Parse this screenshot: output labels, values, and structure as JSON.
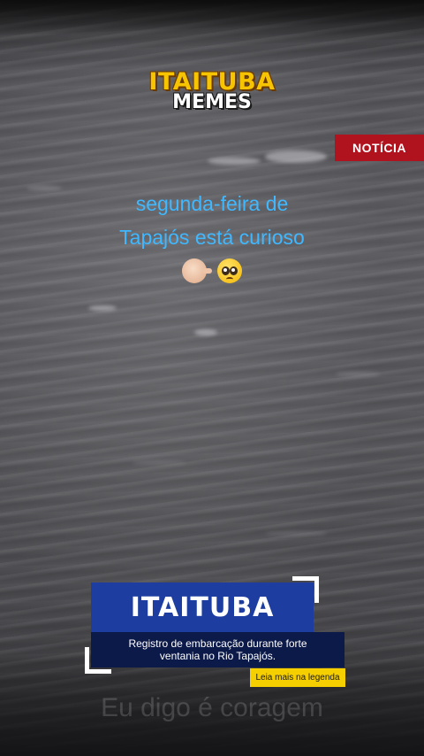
{
  "logo": {
    "line1": "ITAITUBA",
    "line2": "MEMES"
  },
  "badge": {
    "label": "NOTÍCIA"
  },
  "caption": {
    "line1": "segunda-feira de",
    "line2": "Tapajós está curioso"
  },
  "emojis": {
    "first": "pinching-hand-icon",
    "second": "pleading-face-icon"
  },
  "lower_third": {
    "city": "ITAITUBA",
    "headline_line1": "Registro de embarcação durante forte",
    "headline_line2": "ventania no Rio Tapajós.",
    "read_more": "Leia mais na legenda"
  },
  "audio_subtitle": "Eu digo é coragem",
  "colors": {
    "caption_text": "#3fb8ff",
    "badge_bg": "#b0121e",
    "city_bg": "#1d3ea0",
    "headline_bg": "#0c1a4a",
    "read_more_bg": "#f5cf00",
    "logo_gold": "#f6c400"
  }
}
